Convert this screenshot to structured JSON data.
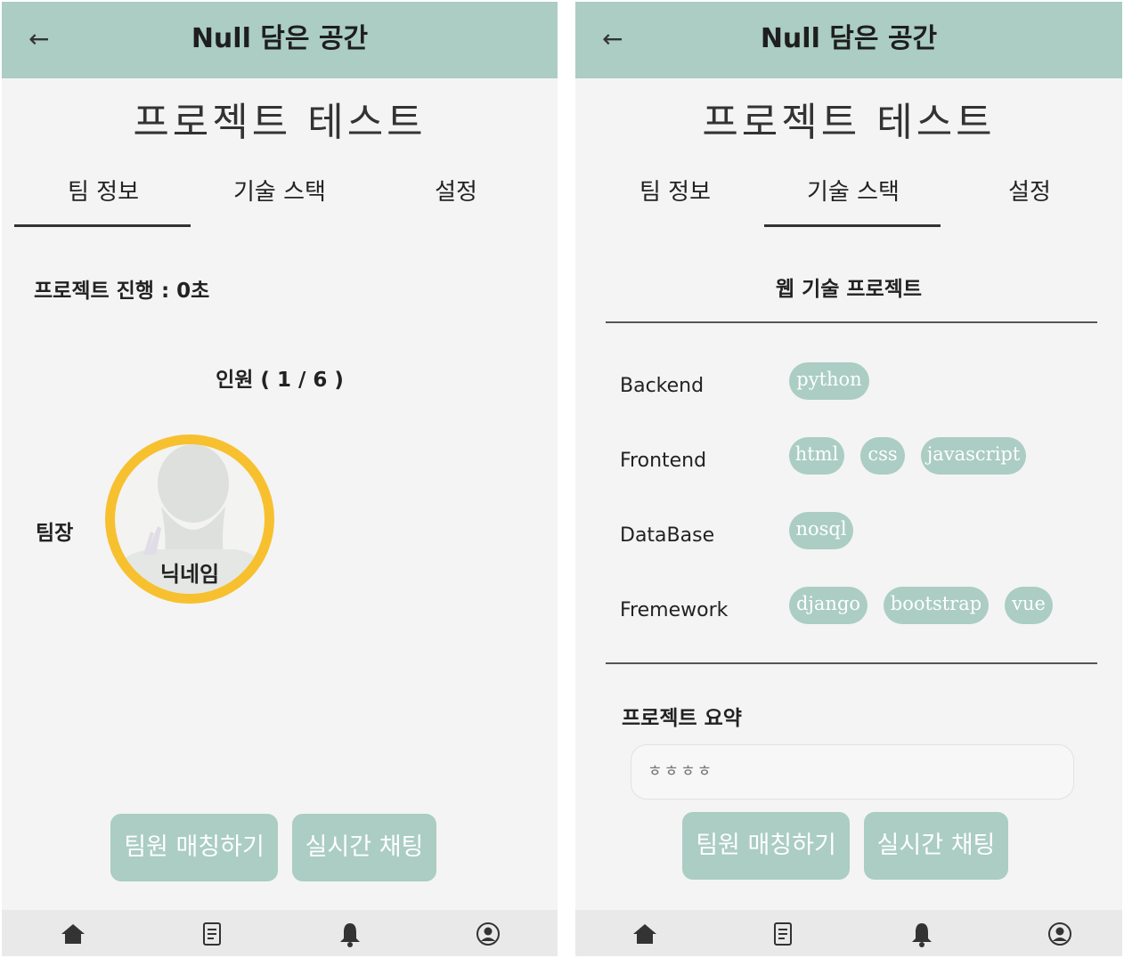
{
  "app": {
    "title": "Null 담은 공간",
    "back_icon": "←"
  },
  "project_title": "프로젝트 테스트",
  "tabs": [
    "팀 정보",
    "기술 스택",
    "설정"
  ],
  "team_info": {
    "progress": "프로젝트 진행 : 0초",
    "members": "인원 ( 1 / 6 )",
    "leader_label": "팀장",
    "leader_nickname": "닉네임"
  },
  "tech_stack": {
    "category": "웹 기술 프로젝트",
    "rows": [
      {
        "label": "Backend",
        "chips": [
          "python"
        ]
      },
      {
        "label": "Frontend",
        "chips": [
          "html",
          "css",
          "javascript"
        ]
      },
      {
        "label": "DataBase",
        "chips": [
          "nosql"
        ]
      },
      {
        "label": "Fremework",
        "chips": [
          "django",
          "bootstrap",
          "vue"
        ]
      }
    ],
    "summary_label": "프로젝트 요약",
    "summary_value": "ㅎㅎㅎㅎ"
  },
  "buttons": {
    "match": "팀원 매칭하기",
    "chat": "실시간 채팅"
  },
  "bottom_nav": [
    "home-icon",
    "document-icon",
    "bell-icon",
    "profile-icon"
  ],
  "colors": {
    "accent": "#abcdc3",
    "avatar_ring": "#f7c02f",
    "background": "#f4f4f4"
  }
}
